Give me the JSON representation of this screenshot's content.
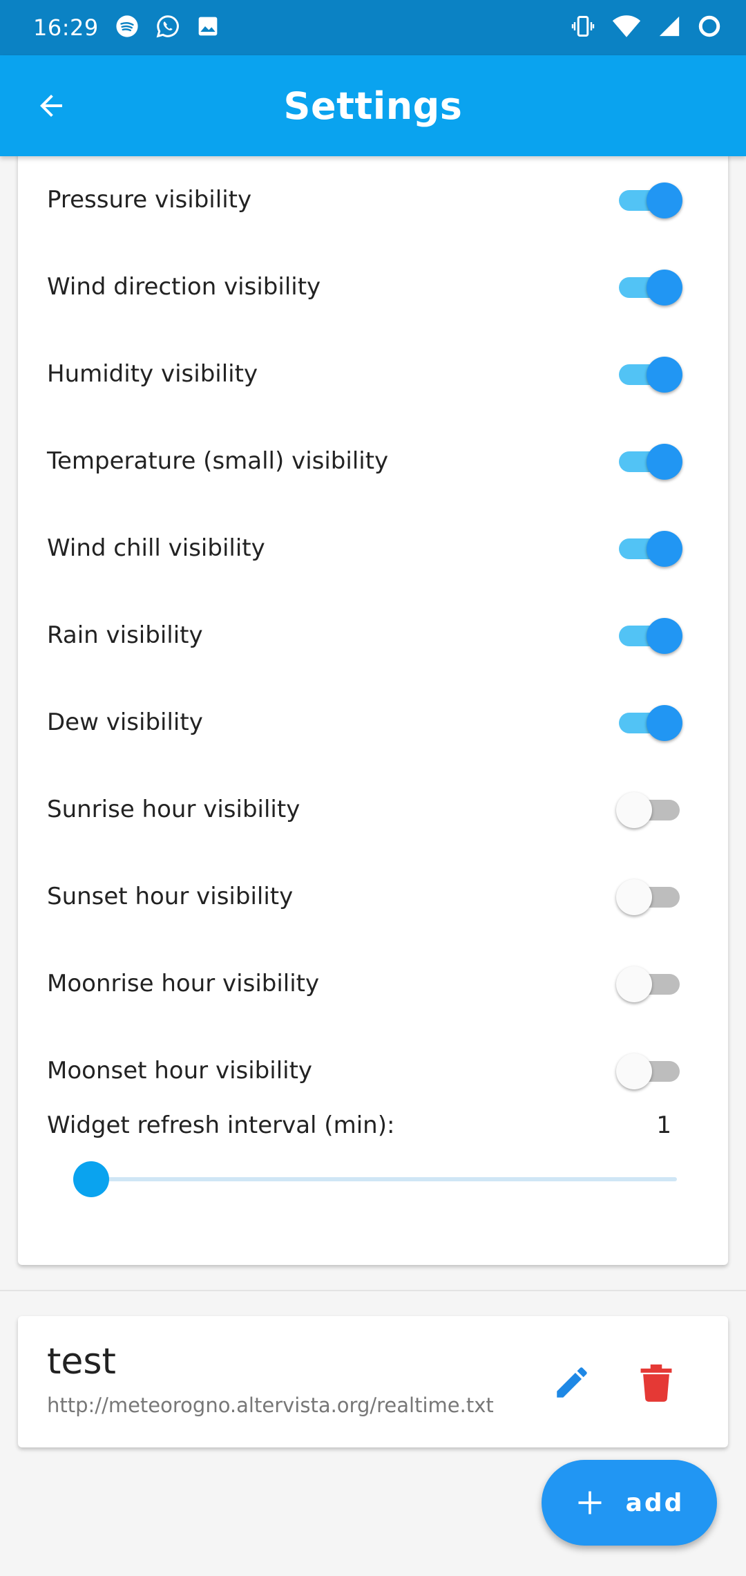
{
  "status_bar": {
    "time": "16:29",
    "left_icons": [
      "spotify-icon",
      "whatsapp-icon",
      "gallery-icon"
    ],
    "right_icons": [
      "vibrate-icon",
      "wifi-icon",
      "signal-icon",
      "circle-status-icon"
    ]
  },
  "app_bar": {
    "title": "Settings",
    "back_icon": "arrow-left-icon"
  },
  "settings": {
    "items": [
      {
        "label": "Pressure visibility",
        "on": true
      },
      {
        "label": "Wind direction visibility",
        "on": true
      },
      {
        "label": "Humidity visibility",
        "on": true
      },
      {
        "label": "Temperature (small) visibility",
        "on": true
      },
      {
        "label": "Wind chill visibility",
        "on": true
      },
      {
        "label": "Rain visibility",
        "on": true
      },
      {
        "label": "Dew visibility",
        "on": true
      },
      {
        "label": "Sunrise hour visibility",
        "on": false
      },
      {
        "label": "Sunset hour visibility",
        "on": false
      },
      {
        "label": "Moonrise hour visibility",
        "on": false
      },
      {
        "label": "Moonset hour visibility",
        "on": false
      }
    ],
    "refresh": {
      "label": "Widget refresh interval (min):",
      "value": "1",
      "slider_fraction": 0
    }
  },
  "server": {
    "name": "test",
    "url": "http://meteorogno.altervista.org/realtime.txt",
    "edit_icon": "pencil-icon",
    "delete_icon": "trash-icon"
  },
  "fab": {
    "label": "add",
    "icon": "plus-icon"
  },
  "colors": {
    "status_bar": "#0b82c4",
    "app_bar": "#0aa3ef",
    "switch_on_thumb": "#2196f3",
    "switch_on_track": "#52c3f5",
    "fab": "#2196f3",
    "edit": "#1e88e5",
    "delete": "#e53935"
  }
}
